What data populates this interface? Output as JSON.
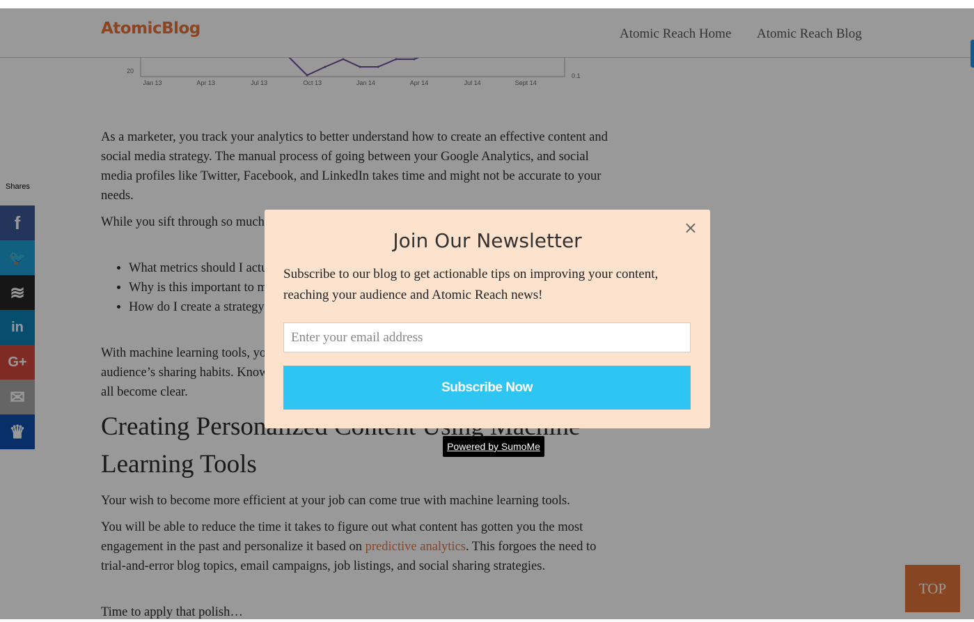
{
  "header": {
    "logo": "AtomicBlog",
    "nav": [
      {
        "label": "Atomic Reach Home"
      },
      {
        "label": "Atomic Reach Blog"
      }
    ]
  },
  "chart": {
    "y_tick": "20",
    "y2_tick": "0.1",
    "x_ticks": [
      "Jan 13",
      "Apr 13",
      "Jul 13",
      "Oct 13",
      "Jan 14",
      "Apr 14",
      "Jul 14",
      "Sept 14"
    ],
    "line_color": "#6b4f9a"
  },
  "article": {
    "p1": "As a marketer, you track your analytics to better understand how to create an effective content and social media strategy. The manual process of going between your Google Analytics, and social media profiles like Twitter, Facebook, and LinkedIn takes time and might not be accurate to your needs.",
    "p2": "While you sift through so much data, you may ask yourself these questions…",
    "bullets": [
      "What metrics should I actually be paying attention to?",
      "Why is this important to my business?",
      "How do I create a strategy around these metrics to drive (traffic, leads, etc.)"
    ],
    "p3": "With machine learning tools, you can gain access to insights that tailor your strategy to your audience’s sharing habits. Knowing which content they click, share, like, and comment will all become clear.",
    "h2": "Creating Personalized Content Using Machine Learning Tools",
    "p4": "Your wish to become more efficient at your job can come true with machine learning tools.",
    "p5a": "You will be able to reduce the time it takes to figure out what content has gotten you the most engagement in the past and personalize it based on ",
    "p5link": "predictive analytics",
    "p5b": ". This forgoes the need to trial-and-error blog topics, email campaigns, job listings, and social sharing strategies.",
    "p6": "Time to apply that polish…"
  },
  "share": {
    "label": "Shares",
    "buttons": [
      {
        "name": "facebook",
        "icon": "facebook-icon",
        "glyph": "f",
        "color": "#3b5998"
      },
      {
        "name": "twitter",
        "icon": "twitter-icon",
        "glyph": "🐦",
        "color": "#1ea0d8"
      },
      {
        "name": "buffer",
        "icon": "buffer-icon",
        "glyph": "≋",
        "color": "#262626"
      },
      {
        "name": "linkedin",
        "icon": "linkedin-icon",
        "glyph": "in",
        "color": "#0a80b8"
      },
      {
        "name": "google-plus",
        "icon": "google-plus-icon",
        "glyph": "G+",
        "color": "#d4473a"
      },
      {
        "name": "email",
        "icon": "mail-icon",
        "glyph": "✉",
        "color": "#a8a8a8"
      },
      {
        "name": "sumome",
        "icon": "crown-icon",
        "glyph": "♛",
        "color": "#0f4fb0"
      }
    ]
  },
  "top_button": "TOP",
  "modal": {
    "title": "Join Our Newsletter",
    "close": "×",
    "description": "Subscribe to our blog to get actionable tips on improving your content, reaching your audience and Atomic Reach news!",
    "email_placeholder": "Enter your email address",
    "subscribe": "Subscribe Now",
    "powered": "Powered by SumoMe"
  }
}
